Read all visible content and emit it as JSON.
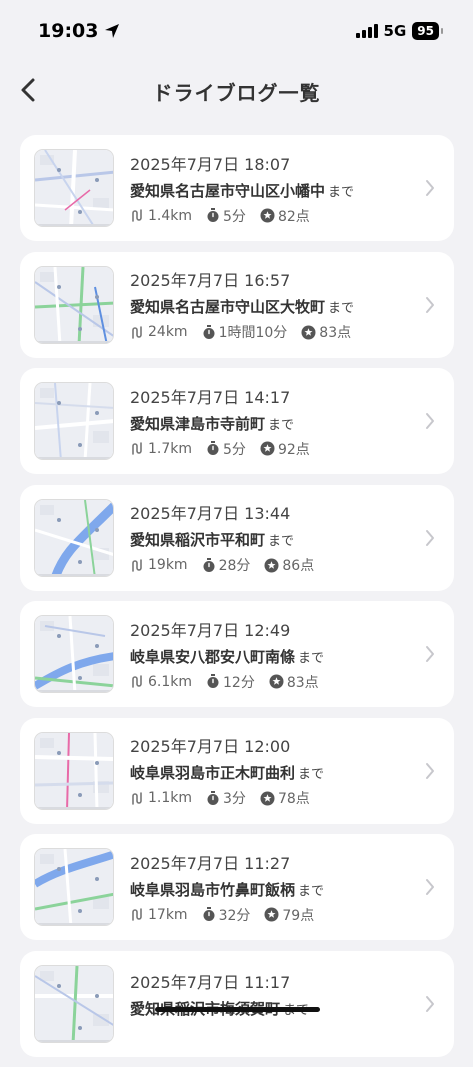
{
  "status": {
    "time": "19:03",
    "network": "5G",
    "battery": "95"
  },
  "header": {
    "title": "ドライブログ一覧"
  },
  "logs": [
    {
      "datetime": "2025年7月7日 18:07",
      "destination": "愛知県名古屋市守山区小幡中",
      "suffix": "まで",
      "distance": "1.4km",
      "duration": "5分",
      "score": "82点"
    },
    {
      "datetime": "2025年7月7日 16:57",
      "destination": "愛知県名古屋市守山区大牧町",
      "suffix": "まで",
      "distance": "24km",
      "duration": "1時間10分",
      "score": "83点"
    },
    {
      "datetime": "2025年7月7日 14:17",
      "destination": "愛知県津島市寺前町",
      "suffix": "まで",
      "distance": "1.7km",
      "duration": "5分",
      "score": "92点"
    },
    {
      "datetime": "2025年7月7日 13:44",
      "destination": "愛知県稲沢市平和町",
      "suffix": "まで",
      "distance": "19km",
      "duration": "28分",
      "score": "86点"
    },
    {
      "datetime": "2025年7月7日 12:49",
      "destination": "岐阜県安八郡安八町南條",
      "suffix": "まで",
      "distance": "6.1km",
      "duration": "12分",
      "score": "83点"
    },
    {
      "datetime": "2025年7月7日 12:00",
      "destination": "岐阜県羽島市正木町曲利",
      "suffix": "まで",
      "distance": "1.1km",
      "duration": "3分",
      "score": "78点"
    },
    {
      "datetime": "2025年7月7日 11:27",
      "destination": "岐阜県羽島市竹鼻町飯柄",
      "suffix": "まで",
      "distance": "17km",
      "duration": "32分",
      "score": "79点"
    },
    {
      "datetime": "2025年7月7日 11:17",
      "destination": "愛知県稲沢市梅須賀町",
      "suffix": "まで",
      "distance": "",
      "duration": "",
      "score": ""
    }
  ],
  "icons": {
    "back": "chevron-left-icon",
    "distance": "route-icon",
    "duration": "stopwatch-icon",
    "score": "star-badge-icon",
    "row": "chevron-right-icon"
  }
}
